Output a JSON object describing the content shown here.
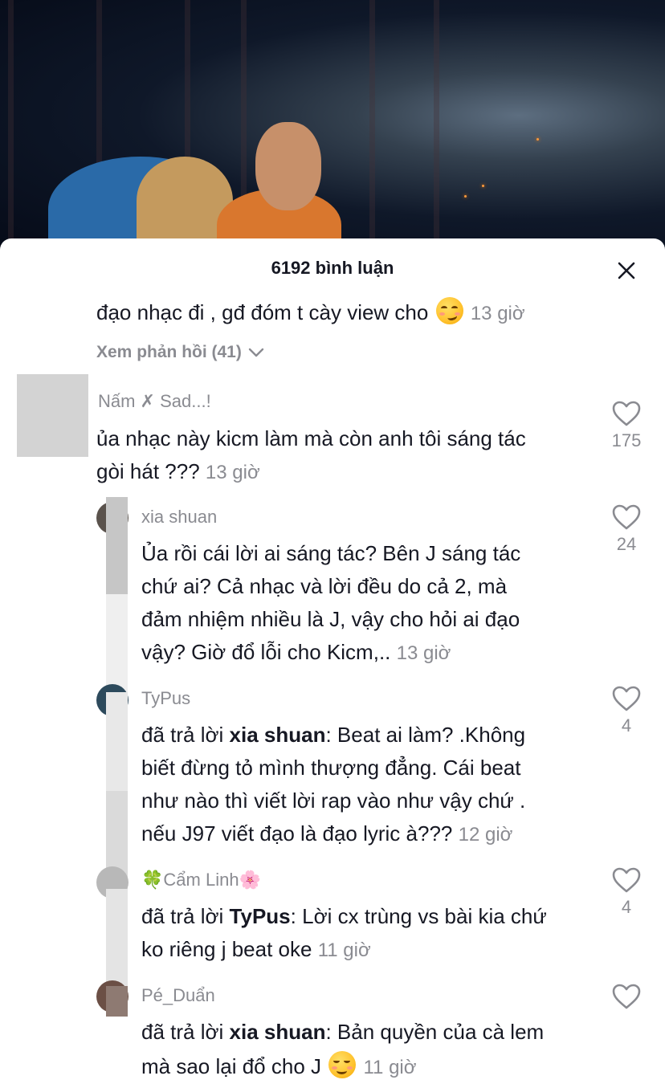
{
  "header": {
    "title": "6192 bình luận",
    "close_icon": "close-icon"
  },
  "partial_comment": {
    "text": "đạo nhạc đi , gđ đóm t cày view cho",
    "emoji": "smirking-face",
    "time": "13 giờ",
    "view_replies": "Xem phản hồi (41)"
  },
  "comment": {
    "username": "Nấm ✗ Sad...!",
    "text_line1": "ủa nhạc này kicm làm mà còn anh tôi sáng tác",
    "text_line2": "gòi hát ???",
    "time": "13 giờ",
    "likes": "175"
  },
  "replies": [
    {
      "username": "xia shuan",
      "lines": [
        "Ủa rồi cái lời ai sáng tác? Bên J sáng tác",
        "chứ ai? Cả nhạc và lời đều do cả 2, mà",
        "đảm nhiệm nhiều là J, vậy cho hỏi ai đạo",
        "vậy? Giờ đổ lỗi cho Kicm,.."
      ],
      "time": "13 giờ",
      "likes": "24"
    },
    {
      "username": "TyPus",
      "reply_prefix": "đã trả lời",
      "reply_to": "xia shuan",
      "first_line_rest": ": Beat ai làm? .Không",
      "lines": [
        "biết đừng tỏ mình thượng đẳng. Cái beat",
        "như nào thì viết lời rap vào như vậy chứ .",
        "nếu J97 viết đạo là đạo lyric à???"
      ],
      "time": "12 giờ",
      "likes": "4"
    },
    {
      "username": "🍀Cẩm Linh🌸",
      "reply_prefix": "đã trả lời",
      "reply_to": "TyPus",
      "first_line_rest": ": Lời cx trùng vs bài kia chứ",
      "lines": [
        "ko riêng j beat oke"
      ],
      "time": "11 giờ",
      "likes": "4"
    },
    {
      "username": "Pé_Duẩn",
      "reply_prefix": "đã trả lời",
      "reply_to": "xia shuan",
      "first_line_rest": ": Bản quyền của cà lem",
      "lines": [
        "mà sao lại đổ cho J"
      ],
      "emoji": "relieved-face",
      "time": "11 giờ",
      "likes": ""
    }
  ],
  "colors": {
    "text": "#161823",
    "muted": "#8a8b91",
    "sheet": "#ffffff"
  }
}
